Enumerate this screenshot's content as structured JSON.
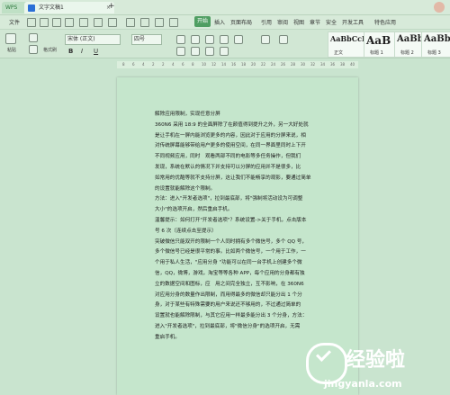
{
  "tabs": {
    "wps": "WPS",
    "doc": "文字文稿1",
    "add": "+",
    "close": "×"
  },
  "menu": {
    "file": "文件",
    "start": "开始",
    "items": [
      "插入",
      "页面布局",
      "引用",
      "审阅",
      "视图",
      "章节",
      "安全",
      "开发工具",
      "特色应用"
    ]
  },
  "ribbon": {
    "paste": "粘贴",
    "format_painter": "格式刷",
    "font_family": "宋体 (正文)",
    "font_size": "四号",
    "bold": "B",
    "italic": "I",
    "underline": "U",
    "styles": [
      {
        "sample": "AaBbCcDd",
        "name": "正文"
      },
      {
        "sample": "AaB",
        "name": "标题 1"
      },
      {
        "sample": "AaBb(",
        "name": "标题 2"
      },
      {
        "sample": "AaBb(",
        "name": "标题 3"
      }
    ]
  },
  "ruler": [
    "8",
    "6",
    "4",
    "2",
    "2",
    "4",
    "6",
    "8",
    "10",
    "12",
    "14",
    "16",
    "18",
    "20",
    "22",
    "24",
    "26",
    "28",
    "30",
    "32",
    "34",
    "36",
    "38",
    "40"
  ],
  "doc": {
    "lines": [
      "解除应用限制，实现任意分屏",
      "360N6 采用 18:9 的全面屏除了在颜值得到提升之外，另一大好处就",
      "是让手机在一屏内能浏览更多的内容，因此对于应用的分屏来说，相",
      "对传统屏幕能够带给用户更多的使用空间，在同一界面里同时上下开",
      "不同视频应用，同时　观看两部不同的电影等多任务操作，但我们",
      "发现，系统在默认的情况下并支持可以分屏的应用并不是很多，比",
      "如常用的优酷等就不支持分屏，这让我们不能畅享的观影，要通过简单",
      "的设置就能解除这个限制。",
      "方法：进入\"开发者选项\"，拉到最底部，将\"强制将活动设为可调整",
      "大小\"的选项开启，然后重启手机。",
      "温馨提示：如何打开\"开发者选项\"？系统设置->关于手机，点击版本",
      "号 6 次（连续点击至提示）",
      "突破微信只能双开的限制一个人同时拥有多个微信号，多个 QQ 号，",
      "多个微信号已经是很平常的事。比如两个微信号，一个用于工作，一",
      "个用于私人生活，\"应用分身 \"功能可以在同一台手机上创建多个微",
      "信，QQ，微博，游戏，淘宝等等各种 APP，每个应用的分身都有独",
      "立的数据空间和图标，应　用之间完全独立，互不影响，在 360N6",
      "对应用分身的数量作出限制，而用得最多的微信却只能分出 1 个分",
      "身，对于某些有特殊需要的用户来说还不够用的，不过通过简单的",
      "设置就也能解除限制，与其它应用一样最多能分出 3 个分身，方法：",
      "进入\"开发者选项\"，拉到最底部，将\"微信分身\"的选项开启，无需",
      "重启手机。"
    ]
  },
  "watermark": {
    "main": "经验啦",
    "sub": "jingyanla.com"
  },
  "colors": {
    "page_bg": "#c5e6cc",
    "app_bg": "#c9e4cf",
    "accent": "#4f9e62"
  }
}
